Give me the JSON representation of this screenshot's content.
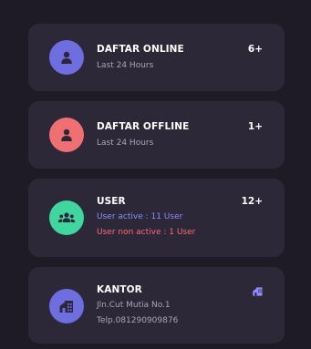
{
  "colors": {
    "online_avatar": "#6f6ee0",
    "offline_avatar": "#ef6f72",
    "user_avatar": "#3fd6a0",
    "kantor_avatar": "#6f6ee0",
    "card_bg": "#2c2838",
    "page_bg": "#1e1b27"
  },
  "cards": [
    {
      "title": "DAFTAR ONLINE",
      "subtitle": "Last 24 Hours",
      "count": "6+",
      "icon": "user-icon"
    },
    {
      "title": "DAFTAR OFFLINE",
      "subtitle": "Last 24 Hours",
      "count": "1+",
      "icon": "user-icon"
    },
    {
      "title": "USER",
      "line1": "User active : 11 User",
      "line2": "User non active : 1 User",
      "count": "12+",
      "icon": "users-group-icon"
    },
    {
      "title": "KANTOR",
      "line1": "Jln.Cut Mutia No.1",
      "line2": "Telp.081290909876",
      "icon": "building-icon"
    }
  ]
}
